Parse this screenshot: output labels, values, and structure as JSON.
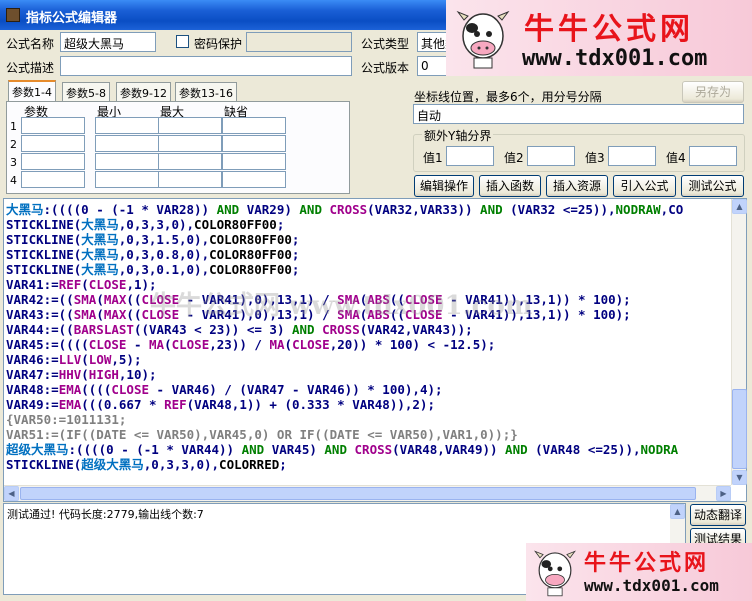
{
  "window": {
    "title": "指标公式编辑器"
  },
  "form": {
    "name_label": "公式名称",
    "name_value": "超级大黑马",
    "password_label": "密码保护",
    "type_label": "公式类型",
    "type_value": "其他类",
    "desc_label": "公式描述",
    "desc_value": "",
    "version_label": "公式版本",
    "version_value": "0"
  },
  "tabs": [
    "参数1-4",
    "参数5-8",
    "参数9-12",
    "参数13-16"
  ],
  "param_grid": {
    "headers": [
      "参数",
      "最小",
      "最大",
      "缺省"
    ],
    "row_numbers": [
      "1",
      "2",
      "3",
      "4"
    ]
  },
  "coords": {
    "label": "坐标线位置，最多6个，用分号分隔",
    "value": "自动"
  },
  "yaxis": {
    "title": "额外Y轴分界",
    "labels": [
      "值1",
      "值2",
      "值3",
      "值4"
    ]
  },
  "buttons": {
    "save_as": "另存为",
    "edit_ops": "编辑操作",
    "insert_func": "插入函数",
    "insert_res": "插入资源",
    "import_formula": "引入公式",
    "test_formula": "测试公式",
    "dynamic_translate": "动态翻译",
    "test_result": "测试结果"
  },
  "watermark": {
    "cn_text": "牛牛公式网",
    "url": "www.tdx001.com",
    "overlay_text": "牛牛公式网 www.tdx001.com"
  },
  "code_lines": [
    "大黑马:((((0 - (-1 * VAR28)) AND VAR29) AND CROSS(VAR32,VAR33)) AND (VAR32 <=25)),NODRAW,CO",
    "STICKLINE(大黑马,0,3,3,0),COLOR80FF00;",
    "STICKLINE(大黑马,0,3,1.5,0),COLOR80FF00;",
    "STICKLINE(大黑马,0,3,0.8,0),COLOR80FF00;",
    "STICKLINE(大黑马,0,3,0.1,0),COLOR80FF00;",
    "VAR41:=REF(CLOSE,1);",
    "VAR42:=((SMA(MAX((CLOSE - VAR41),0),13,1) / SMA(ABS((CLOSE - VAR41)),13,1)) * 100);",
    "VAR43:=((SMA(MAX((CLOSE - VAR41),0),13,1) / SMA(ABS((CLOSE - VAR41)),13,1)) * 100);",
    "VAR44:=((BARSLAST((VAR43 < 23)) <= 3) AND CROSS(VAR42,VAR43));",
    "VAR45:=((((CLOSE - MA(CLOSE,23)) / MA(CLOSE,20)) * 100) < -12.5);",
    "VAR46:=LLV(LOW,5);",
    "VAR47:=HHV(HIGH,10);",
    "VAR48:=EMA((((CLOSE - VAR46) / (VAR47 - VAR46)) * 100),4);",
    "VAR49:=EMA(((0.667 * REF(VAR48,1)) + (0.333 * VAR48)),2);",
    "{VAR50:=1011131;",
    "VAR51:=(IF((DATE <= VAR50),VAR45,0) OR IF((DATE <= VAR50),VAR1,0));}",
    "超级大黑马:((((0 - (-1 * VAR44)) AND VAR45) AND CROSS(VAR48,VAR49)) AND (VAR48 <=25)),NODRA",
    "STICKLINE(超级大黑马,0,3,3,0),COLORRED;"
  ],
  "output": {
    "message": "测试通过! 代码长度:2779,输出线个数:7"
  },
  "colors": {
    "code_default": "#000080",
    "keyword": "#007f00",
    "function": "#a0008c",
    "comment": "#808080",
    "highlight": "#0070c0",
    "number": "#000080"
  }
}
